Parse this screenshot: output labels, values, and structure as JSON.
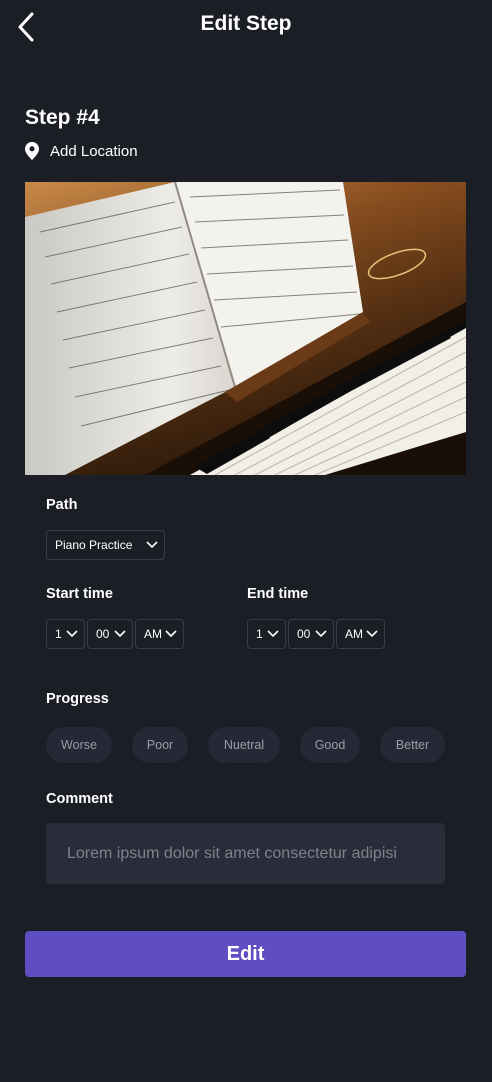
{
  "header": {
    "title": "Edit Step"
  },
  "step": {
    "title": "Step #4",
    "location_label": "Add Location"
  },
  "photo": {
    "subject": "sheet music on an upright piano"
  },
  "path": {
    "label": "Path",
    "selected": "Piano Practice"
  },
  "start_time": {
    "label": "Start time",
    "hour": "1",
    "minute": "00",
    "meridiem": "AM"
  },
  "end_time": {
    "label": "End time",
    "hour": "1",
    "minute": "00",
    "meridiem": "AM"
  },
  "progress": {
    "label": "Progress",
    "options": [
      "Worse",
      "Poor",
      "Nuetral",
      "Good",
      "Better"
    ]
  },
  "comment": {
    "label": "Comment",
    "placeholder": "Lorem ipsum dolor sit amet consectetur adipisi"
  },
  "actions": {
    "edit_label": "Edit"
  },
  "colors": {
    "background": "#1c1e26",
    "accent": "#5f4dc2",
    "pill": "#262935",
    "input": "#2a2d39"
  }
}
